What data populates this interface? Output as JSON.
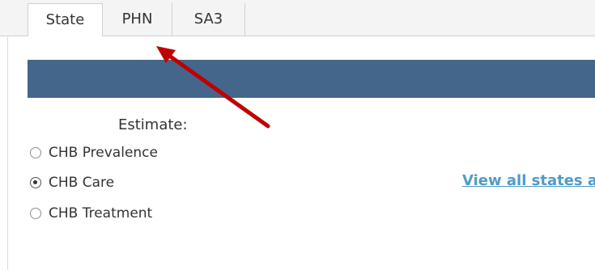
{
  "tabs": [
    {
      "label": "State",
      "active": true
    },
    {
      "label": "PHN",
      "active": false
    },
    {
      "label": "SA3",
      "active": false
    }
  ],
  "banner_color": "#44668b",
  "estimate": {
    "label": "Estimate:",
    "options": [
      {
        "label": "CHB Prevalence",
        "selected": false
      },
      {
        "label": "CHB Care",
        "selected": true
      },
      {
        "label": "CHB Treatment",
        "selected": false
      }
    ]
  },
  "link": {
    "text": "View all states a",
    "color": "#4f9bc9"
  },
  "annotation": {
    "color": "#c00000",
    "icon": "arrow-icon"
  }
}
